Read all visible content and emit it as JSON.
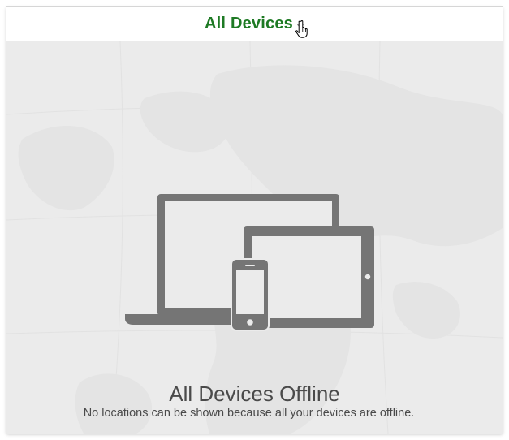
{
  "header": {
    "device_selector_label": "All Devices"
  },
  "empty_state": {
    "title": "All Devices Offline",
    "message": "No locations can be shown because all your devices are offline."
  },
  "colors": {
    "accent_green": "#1e7a24",
    "device_gray": "#757575",
    "map_background": "#ebebeb"
  },
  "icons": {
    "selector": "chevron-down-icon",
    "cursor": "hand-pointer-icon",
    "illustration": "devices-illustration-icon"
  }
}
